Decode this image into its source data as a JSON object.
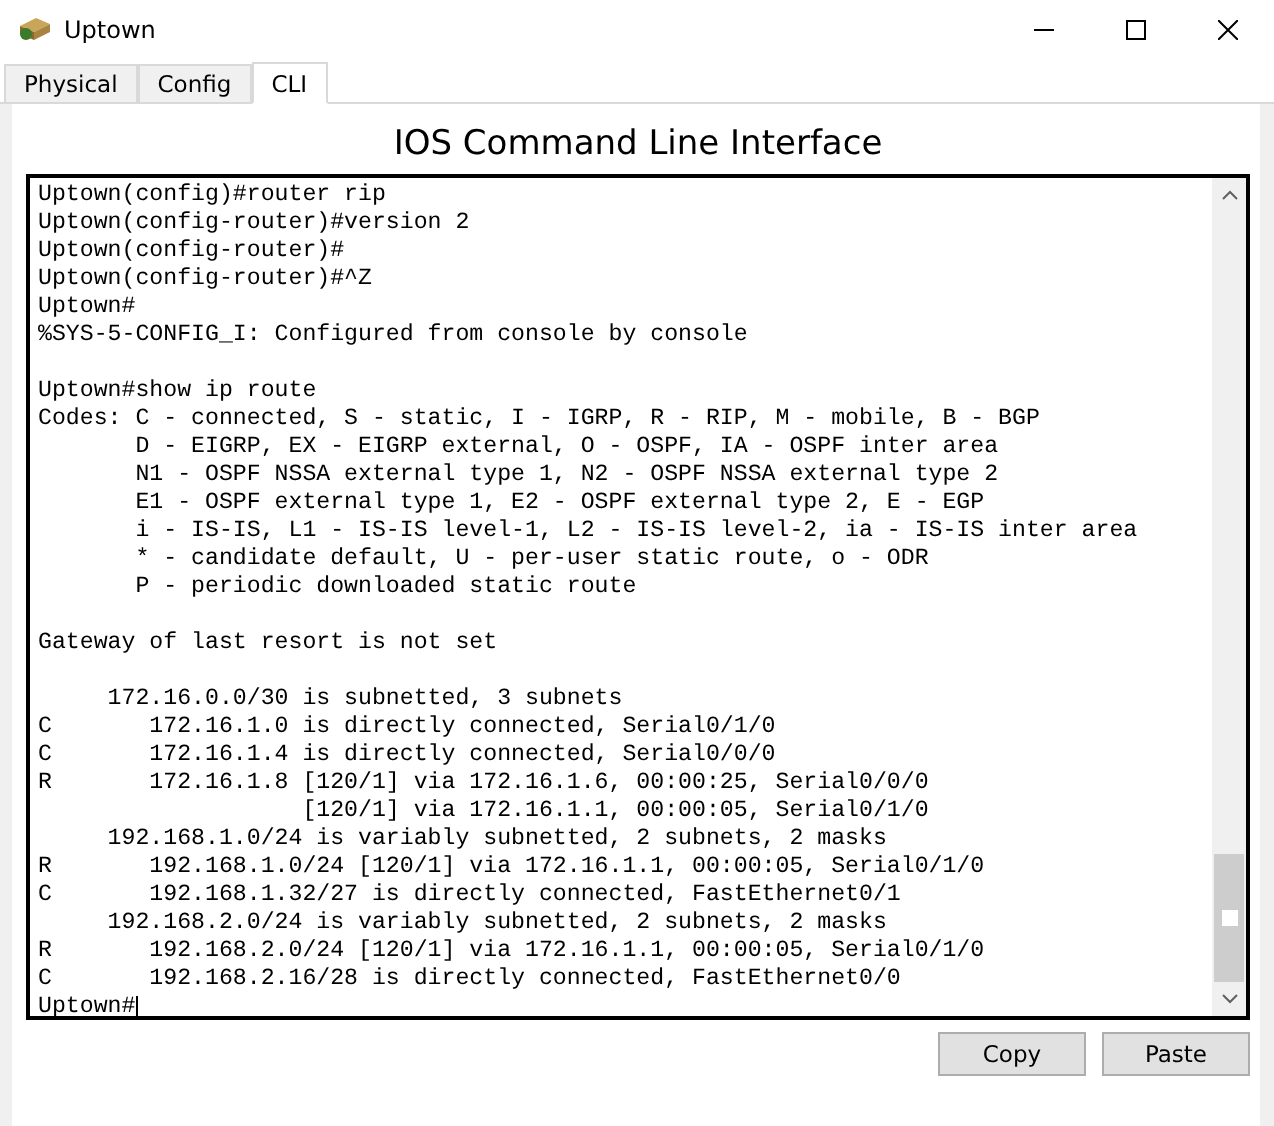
{
  "window": {
    "title": "Uptown"
  },
  "tabs": [
    {
      "label": "Physical",
      "selected": false
    },
    {
      "label": "Config",
      "selected": false
    },
    {
      "label": "CLI",
      "selected": true
    }
  ],
  "heading": "IOS Command Line Interface",
  "terminal": {
    "lines": [
      {
        "kind": "text",
        "text": "Uptown(config)#router rip"
      },
      {
        "kind": "text",
        "text": "Uptown(config-router)#version 2"
      },
      {
        "kind": "text",
        "text": "Uptown(config-router)#"
      },
      {
        "kind": "text",
        "text": "Uptown(config-router)#^Z"
      },
      {
        "kind": "text",
        "text": "Uptown#"
      },
      {
        "kind": "text",
        "text": "%SYS-5-CONFIG_I: Configured from console by console"
      },
      {
        "kind": "blank"
      },
      {
        "kind": "text",
        "text": "Uptown#show ip route"
      },
      {
        "kind": "text",
        "text": "Codes: C - connected, S - static, I - IGRP, R - RIP, M - mobile, B - BGP"
      },
      {
        "kind": "text",
        "text": "       D - EIGRP, EX - EIGRP external, O - OSPF, IA - OSPF inter area"
      },
      {
        "kind": "text",
        "text": "       N1 - OSPF NSSA external type 1, N2 - OSPF NSSA external type 2"
      },
      {
        "kind": "text",
        "text": "       E1 - OSPF external type 1, E2 - OSPF external type 2, E - EGP"
      },
      {
        "kind": "text",
        "text": "       i - IS-IS, L1 - IS-IS level-1, L2 - IS-IS level-2, ia - IS-IS inter area"
      },
      {
        "kind": "text",
        "text": "       * - candidate default, U - per-user static route, o - ODR"
      },
      {
        "kind": "text",
        "text": "       P - periodic downloaded static route"
      },
      {
        "kind": "blank"
      },
      {
        "kind": "text",
        "text": "Gateway of last resort is not set"
      },
      {
        "kind": "blank"
      },
      {
        "kind": "text",
        "text": "     172.16.0.0/30 is subnetted, 3 subnets"
      },
      {
        "kind": "text",
        "text": "C       172.16.1.0 is directly connected, Serial0/1/0"
      },
      {
        "kind": "text",
        "text": "C       172.16.1.4 is directly connected, Serial0/0/0"
      },
      {
        "kind": "text",
        "text": "R       172.16.1.8 [120/1] via 172.16.1.6, 00:00:25, Serial0/0/0"
      },
      {
        "kind": "text",
        "text": "                   [120/1] via 172.16.1.1, 00:00:05, Serial0/1/0"
      },
      {
        "kind": "text",
        "text": "     192.168.1.0/24 is variably subnetted, 2 subnets, 2 masks"
      },
      {
        "kind": "text",
        "text": "R       192.168.1.0/24 [120/1] via 172.16.1.1, 00:00:05, Serial0/1/0"
      },
      {
        "kind": "text",
        "text": "C       192.168.1.32/27 is directly connected, FastEthernet0/1"
      },
      {
        "kind": "text",
        "text": "     192.168.2.0/24 is variably subnetted, 2 subnets, 2 masks"
      },
      {
        "kind": "text",
        "text": "R       192.168.2.0/24 [120/1] via 172.16.1.1, 00:00:05, Serial0/1/0"
      },
      {
        "kind": "text",
        "text": "C       192.168.2.16/28 is directly connected, FastEthernet0/0"
      },
      {
        "kind": "prompt",
        "text": "Uptown#"
      }
    ]
  },
  "buttons": [
    "Copy",
    "Paste"
  ]
}
